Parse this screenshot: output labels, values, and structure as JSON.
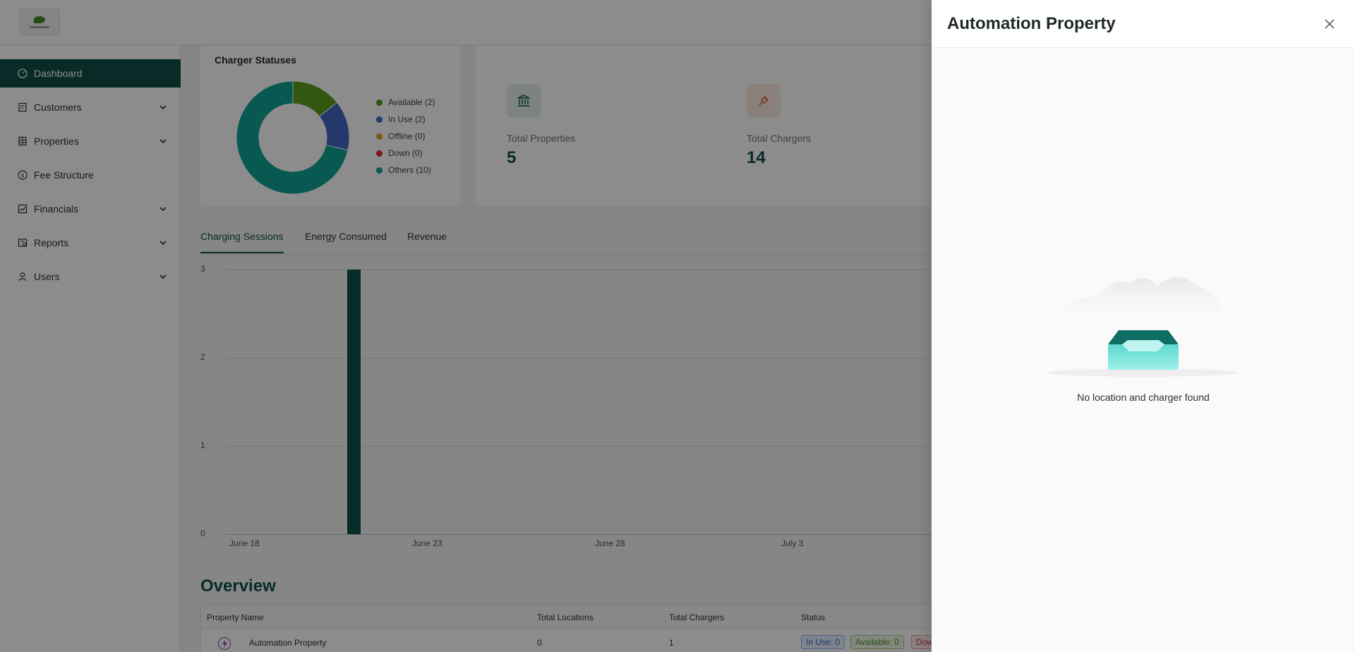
{
  "header": {
    "logo": "brand-logo"
  },
  "sidebar": {
    "items": [
      {
        "label": "Dashboard",
        "icon": "dashboard-icon",
        "active": true,
        "expandable": false
      },
      {
        "label": "Customers",
        "icon": "customers-icon",
        "expandable": true
      },
      {
        "label": "Properties",
        "icon": "properties-icon",
        "expandable": true
      },
      {
        "label": "Fee Structure",
        "icon": "dollar-icon",
        "expandable": false
      },
      {
        "label": "Financials",
        "icon": "chart-line-icon",
        "expandable": true
      },
      {
        "label": "Reports",
        "icon": "report-icon",
        "expandable": true
      },
      {
        "label": "Users",
        "icon": "user-icon",
        "expandable": true
      }
    ]
  },
  "charger_statuses": {
    "title": "Charger Statuses",
    "legend": [
      {
        "label": "Available (2)",
        "color": "#5a9e1f"
      },
      {
        "label": "In Use (2)",
        "color": "#4467c4"
      },
      {
        "label": "Offline (0)",
        "color": "#e0a020"
      },
      {
        "label": "Down (0)",
        "color": "#d92b2b"
      },
      {
        "label": "Others (10)",
        "color": "#0fa394"
      }
    ]
  },
  "stats": {
    "total_properties": {
      "label": "Total Properties",
      "value": "5",
      "icon": "bank-icon"
    },
    "total_chargers": {
      "label": "Total Chargers",
      "value": "14",
      "icon": "plug-icon"
    }
  },
  "tabs": [
    {
      "label": "Charging Sessions",
      "active": true
    },
    {
      "label": "Energy Consumed",
      "active": false
    },
    {
      "label": "Revenue",
      "active": false
    }
  ],
  "chart_data": [
    {
      "type": "pie",
      "title": "Charger Statuses",
      "categories": [
        "Available",
        "In Use",
        "Offline",
        "Down",
        "Others"
      ],
      "values": [
        2,
        2,
        0,
        0,
        10
      ],
      "colors": [
        "#5a9e1f",
        "#4467c4",
        "#e0a020",
        "#d92b2b",
        "#0fa394"
      ],
      "donut": true
    },
    {
      "type": "bar",
      "title": "",
      "x_ticks": [
        "June 18",
        "June 23",
        "June 28",
        "July 3"
      ],
      "y_ticks": [
        "0",
        "1",
        "2",
        "3"
      ],
      "categories": [
        "June 21"
      ],
      "values": [
        3
      ],
      "ylim": [
        0,
        3
      ],
      "color": "#0f4f47",
      "grid": true
    }
  ],
  "overview": {
    "title": "Overview",
    "columns": [
      "Property Name",
      "Total Locations",
      "Total Chargers",
      "Status"
    ],
    "rows": [
      {
        "name": "Automation Property",
        "locations": "0",
        "chargers": "1",
        "badges": [
          "In Use: 0",
          "Available: 0",
          "Dow"
        ]
      }
    ]
  },
  "drawer": {
    "title": "Automation Property",
    "empty_text": "No location and charger found"
  }
}
